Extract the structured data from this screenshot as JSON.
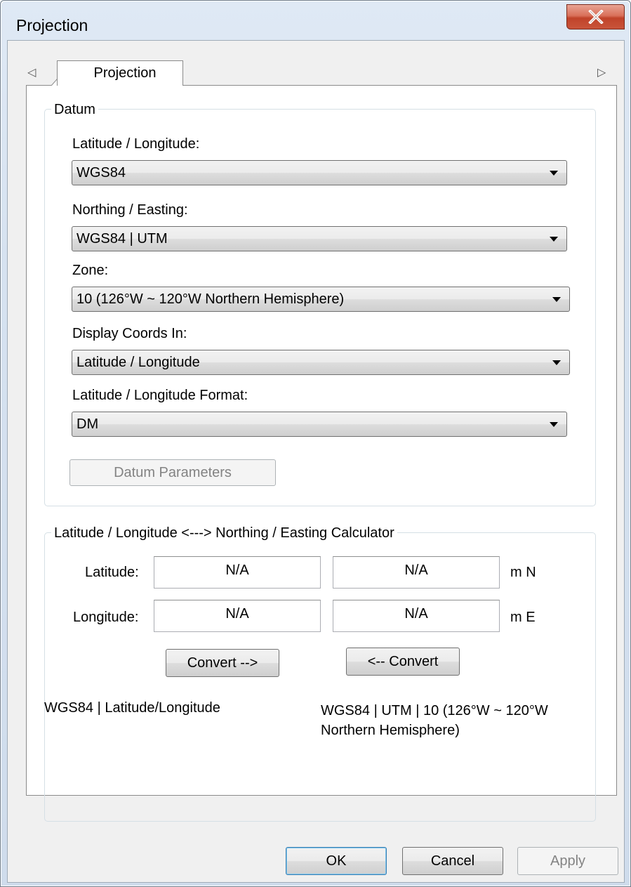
{
  "window": {
    "title": "Projection",
    "close_glyph": "✕"
  },
  "tabs": {
    "scroll_left": "◁",
    "scroll_right": "▷",
    "items": [
      {
        "label": "Projection",
        "selected": true
      }
    ]
  },
  "datum": {
    "legend": "Datum",
    "lat_lon_label": "Latitude / Longitude:",
    "lat_lon_value": "WGS84",
    "north_east_label": "Northing / Easting:",
    "north_east_value": "WGS84 | UTM",
    "zone_label": "Zone:",
    "zone_value": "10  (126°W ~ 120°W Northern Hemisphere)",
    "display_label": "Display Coords In:",
    "display_value": "Latitude / Longitude",
    "format_label": "Latitude / Longitude Format:",
    "format_value": "DM",
    "params_button": "Datum Parameters"
  },
  "calculator": {
    "legend": "Latitude / Longitude <---> Northing / Easting Calculator",
    "latitude_label": "Latitude:",
    "longitude_label": "Longitude:",
    "latitude_value": "N/A",
    "longitude_value": "N/A",
    "northing_value": "N/A",
    "easting_value": "N/A",
    "northing_unit": "m N",
    "easting_unit": "m E",
    "convert_right": "Convert -->",
    "convert_left": "<-- Convert",
    "left_datum": "WGS84 | Latitude/Longitude",
    "right_datum": "WGS84 | UTM | 10  (126°W ~ 120°W Northern Hemisphere)"
  },
  "footer": {
    "ok": "OK",
    "cancel": "Cancel",
    "apply": "Apply"
  },
  "icons": [
    "close-icon",
    "chevron-left-icon",
    "chevron-right-icon",
    "dropdown-arrow-icon"
  ]
}
